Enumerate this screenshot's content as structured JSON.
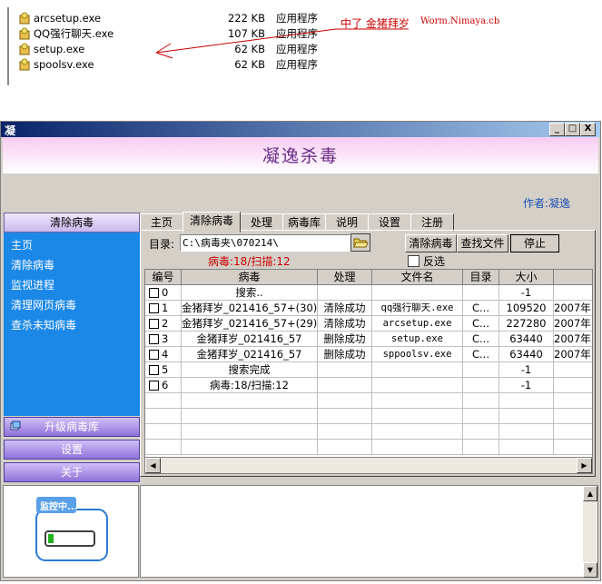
{
  "files": [
    {
      "name": "arcsetup.exe",
      "size": "222 KB",
      "type": "应用程序"
    },
    {
      "name": "QQ强行聊天.exe",
      "size": "107 KB",
      "type": "应用程序"
    },
    {
      "name": "setup.exe",
      "size": "62 KB",
      "type": "应用程序"
    },
    {
      "name": "spoolsv.exe",
      "size": "62 KB",
      "type": "应用程序"
    }
  ],
  "annotation": {
    "text": "中了 金猪拜岁",
    "url": "Worm.Nimaya.cb"
  },
  "window": {
    "title": "凝",
    "banner_title": "凝逸杀毒",
    "author": "作者:凝逸",
    "min_label": "_",
    "max_label": "□",
    "close_label": "X"
  },
  "left": {
    "header": "清除病毒",
    "items": [
      "主页",
      "清除病毒",
      "监视进程",
      "清理网页病毒",
      "查杀未知病毒"
    ],
    "upgrade": "升级病毒库",
    "settings": "设置",
    "about": "关于"
  },
  "tabs": [
    "主页",
    "清除病毒",
    "处理",
    "病毒库",
    "说明",
    "设置",
    "注册"
  ],
  "scan": {
    "dir_label": "目录:",
    "dir_value": "C:\\病毒夹\\070214\\",
    "status": "病毒:18/扫描:12",
    "btn_clear": "清除病毒",
    "btn_find": "查找文件",
    "btn_stop": "停止",
    "invert_label": "反选"
  },
  "table": {
    "headers": [
      "编号",
      "病毒",
      "处理",
      "文件名",
      "目录",
      "大小",
      ""
    ],
    "rows": [
      {
        "id": "0",
        "virus": "搜索..",
        "action": "",
        "file": "",
        "dir": "",
        "size": "-1",
        "date": ""
      },
      {
        "id": "1",
        "virus": "金猪拜岁_021416_57+(30)",
        "action": "清除成功",
        "file": "qq强行聊天.exe",
        "dir": "C...",
        "size": "109520",
        "date": "2007年"
      },
      {
        "id": "2",
        "virus": "金猪拜岁_021416_57+(29)",
        "action": "清除成功",
        "file": "arcsetup.exe",
        "dir": "C...",
        "size": "227280",
        "date": "2007年"
      },
      {
        "id": "3",
        "virus": "金猪拜岁_021416_57",
        "action": "删除成功",
        "file": "setup.exe",
        "dir": "C...",
        "size": "63440",
        "date": "2007年"
      },
      {
        "id": "4",
        "virus": "金猪拜岁_021416_57",
        "action": "删除成功",
        "file": "sppoolsv.exe",
        "dir": "C...",
        "size": "63440",
        "date": "2007年"
      },
      {
        "id": "5",
        "virus": "搜索完成",
        "action": "",
        "file": "",
        "dir": "",
        "size": "-1",
        "date": ""
      },
      {
        "id": "6",
        "virus": "病毒:18/扫描:12",
        "action": "",
        "file": "",
        "dir": "",
        "size": "-1",
        "date": ""
      }
    ]
  },
  "monitor_label": "监控中...",
  "colors": {
    "accent": "#1b88e8",
    "banner": "#f7ccf2",
    "title_text": "#6a2d88",
    "status_red": "#cc0000"
  }
}
